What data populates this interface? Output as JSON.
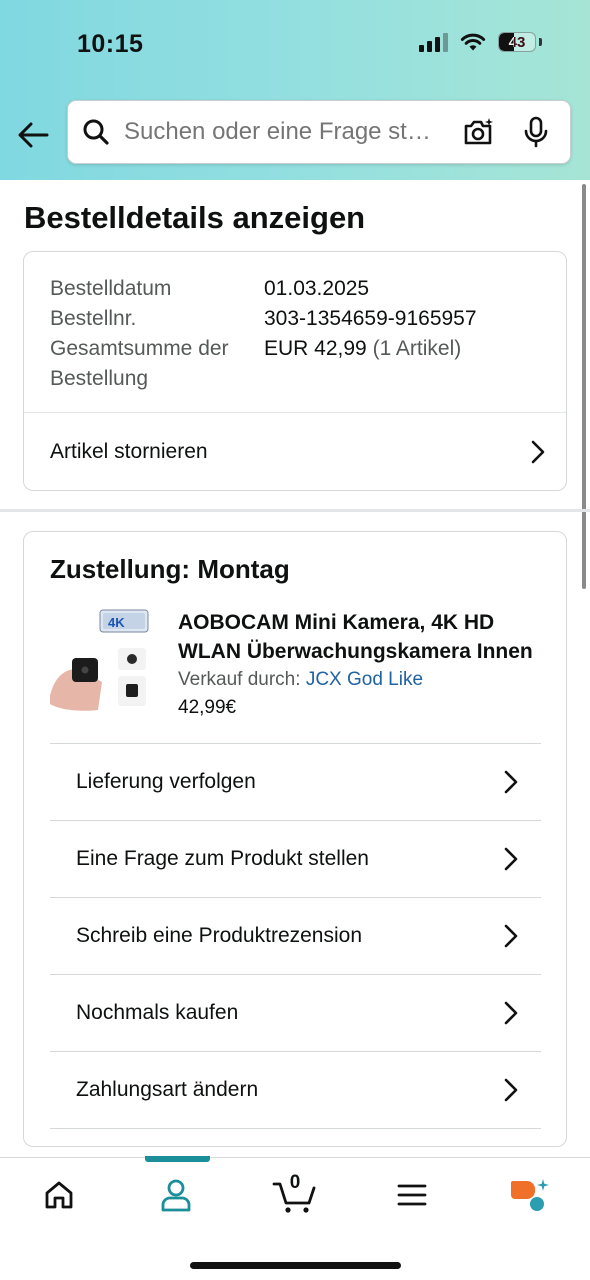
{
  "status_bar": {
    "time": "10:15",
    "battery": "43",
    "battery_level": 0.43
  },
  "search": {
    "placeholder": "Suchen oder eine Frage stellen"
  },
  "page": {
    "title": "Bestelldetails anzeigen"
  },
  "order_summary": {
    "rows": [
      {
        "label": "Bestelldatum",
        "value": "01.03.2025",
        "extra": ""
      },
      {
        "label": "Bestellnr.",
        "value": "303-1354659-9165957",
        "extra": ""
      },
      {
        "label": "Gesamtsumme der Bestellung",
        "value": "EUR 42,99",
        "extra": "(1 Artikel)"
      }
    ],
    "cancel_label": "Artikel stornieren"
  },
  "delivery": {
    "title": "Zustellung: Montag",
    "product": {
      "title": "AOBOCAM Mini Kamera, 4K HD WLAN Überwachungskamera Innen",
      "seller_prefix": "Verkauf durch:",
      "seller_name": "JCX God Like",
      "price": "42,99€",
      "image_badge": "4K"
    },
    "actions": [
      {
        "label": "Lieferung verfolgen"
      },
      {
        "label": "Eine Frage zum Produkt stellen"
      },
      {
        "label": "Schreib eine Produktrezension"
      },
      {
        "label": "Nochmals kaufen"
      },
      {
        "label": "Zahlungsart ändern"
      }
    ]
  },
  "tab_bar": {
    "active_tab": "account",
    "cart_count": "0",
    "accent_color": "#1a8e99",
    "tabs": [
      "home-icon",
      "account-icon",
      "cart-icon",
      "menu-icon",
      "rufus-icon"
    ]
  },
  "colors": {
    "header_start": "#80d8e0",
    "header_end": "#a6e5d6",
    "link": "#2162a1",
    "text_muted": "#565959"
  }
}
